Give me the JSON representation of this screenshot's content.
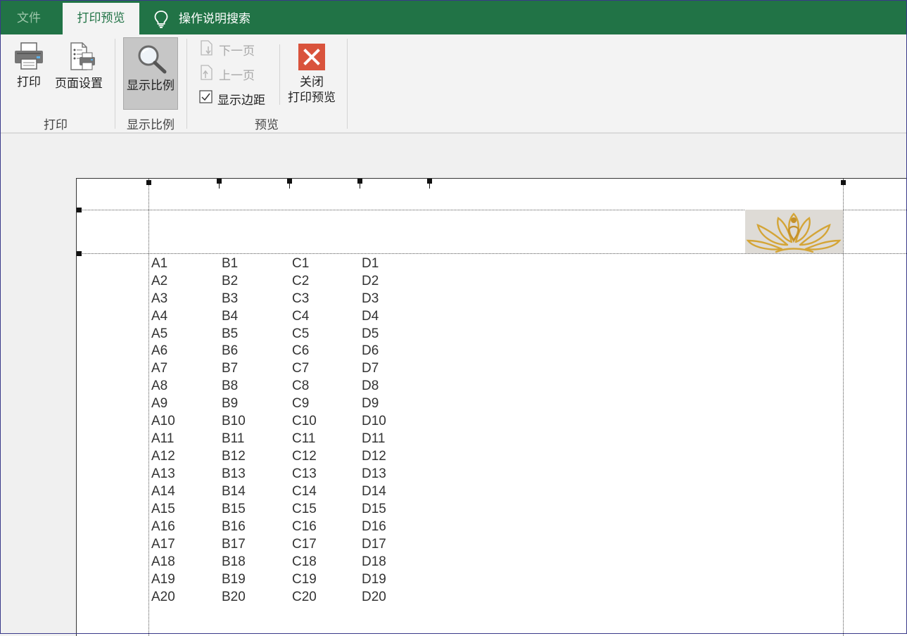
{
  "tabs": {
    "file": "文件",
    "print_preview": "打印预览",
    "search": "操作说明搜索"
  },
  "ribbon": {
    "print_group": {
      "print_label": "打印",
      "page_setup_label": "页面设置",
      "group_label": "打印"
    },
    "zoom_group": {
      "zoom_label": "显示比例",
      "group_label": "显示比例"
    },
    "preview_group": {
      "next_page": "下一页",
      "prev_page": "上一页",
      "show_margins": "显示边距",
      "show_margins_checked": true,
      "close_line1": "关闭",
      "close_line2": "打印预览",
      "group_label": "预览"
    }
  },
  "sheet": {
    "rows": [
      [
        "A1",
        "B1",
        "C1",
        "D1"
      ],
      [
        "A2",
        "B2",
        "C2",
        "D2"
      ],
      [
        "A3",
        "B3",
        "C3",
        "D3"
      ],
      [
        "A4",
        "B4",
        "C4",
        "D4"
      ],
      [
        "A5",
        "B5",
        "C5",
        "D5"
      ],
      [
        "A6",
        "B6",
        "C6",
        "D6"
      ],
      [
        "A7",
        "B7",
        "C7",
        "D7"
      ],
      [
        "A8",
        "B8",
        "C8",
        "D8"
      ],
      [
        "A9",
        "B9",
        "C9",
        "D9"
      ],
      [
        "A10",
        "B10",
        "C10",
        "D10"
      ],
      [
        "A11",
        "B11",
        "C11",
        "D11"
      ],
      [
        "A12",
        "B12",
        "C12",
        "D12"
      ],
      [
        "A13",
        "B13",
        "C13",
        "D13"
      ],
      [
        "A14",
        "B14",
        "C14",
        "D14"
      ],
      [
        "A15",
        "B15",
        "C15",
        "D15"
      ],
      [
        "A16",
        "B16",
        "C16",
        "D16"
      ],
      [
        "A17",
        "B17",
        "C17",
        "D17"
      ],
      [
        "A18",
        "B18",
        "C18",
        "D18"
      ],
      [
        "A19",
        "B19",
        "C19",
        "D19"
      ],
      [
        "A20",
        "B20",
        "C20",
        "D20"
      ]
    ]
  },
  "colors": {
    "accent": "#217346",
    "close_icon": "#d9533c",
    "logo_gold": "#d4a537"
  },
  "icons": [
    "printer-icon",
    "page-setup-icon",
    "magnifier-icon",
    "next-page-icon",
    "prev-page-icon",
    "checkbox-icon",
    "close-preview-icon",
    "lightbulb-icon",
    "lotus-logo"
  ]
}
